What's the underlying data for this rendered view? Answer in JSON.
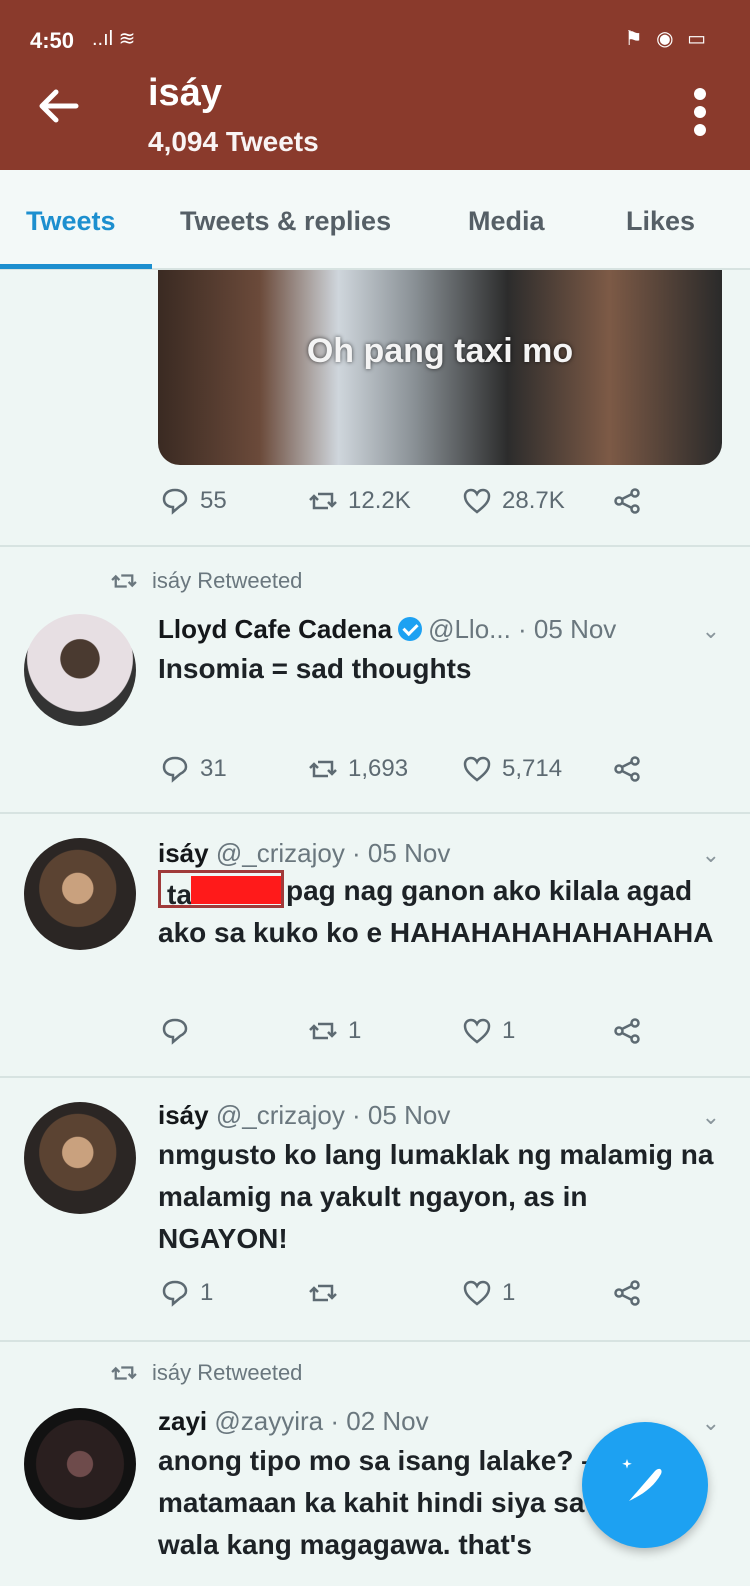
{
  "status_bar": {
    "time": "4:50",
    "signal": "..ıl ≋",
    "right_icons": "⚑ ◉ ▭"
  },
  "header": {
    "profile_name": "isáy",
    "tweet_count": "4,094 Tweets"
  },
  "tabs": [
    {
      "label": "Tweets",
      "active": true
    },
    {
      "label": "Tweets & replies",
      "active": false
    },
    {
      "label": "Media",
      "active": false
    },
    {
      "label": "Likes",
      "active": false
    }
  ],
  "tweets": [
    {
      "media_caption": "Oh pang taxi mo",
      "replies": "55",
      "retweets": "12.2K",
      "likes": "28.7K"
    },
    {
      "retweeted_by": "isáy Retweeted",
      "name": "Lloyd Cafe Cadena",
      "handle_date": "@Llo... · 05 Nov",
      "text": "Insomia = sad thoughts",
      "replies": "31",
      "retweets": "1,693",
      "likes": "5,714"
    },
    {
      "name": "isáy",
      "handle_date": "@_crizajoy · 05 Nov",
      "text_lead": "ta",
      "text": "pag nag ganon ako kilala agad ako sa kuko ko e HAHAHAHAHAHAHAHA",
      "replies": "",
      "retweets": "1",
      "likes": "1"
    },
    {
      "name": "isáy",
      "handle_date": "@_crizajoy · 05 Nov",
      "text": "nmgusto ko lang lumaklak ng malamig na malamig na yakult ngayon, as in NGAYON!",
      "replies": "1",
      "retweets": "",
      "likes": "1"
    },
    {
      "retweeted_by": "isáy Retweeted",
      "name": "zayi",
      "handle_date": "@zayyira · 02 Nov",
      "text": "anong tipo mo sa isang lalake? – na matamaan ka kahit hindi siya sa tipo mo, wala kang magagawa. that's"
    }
  ]
}
